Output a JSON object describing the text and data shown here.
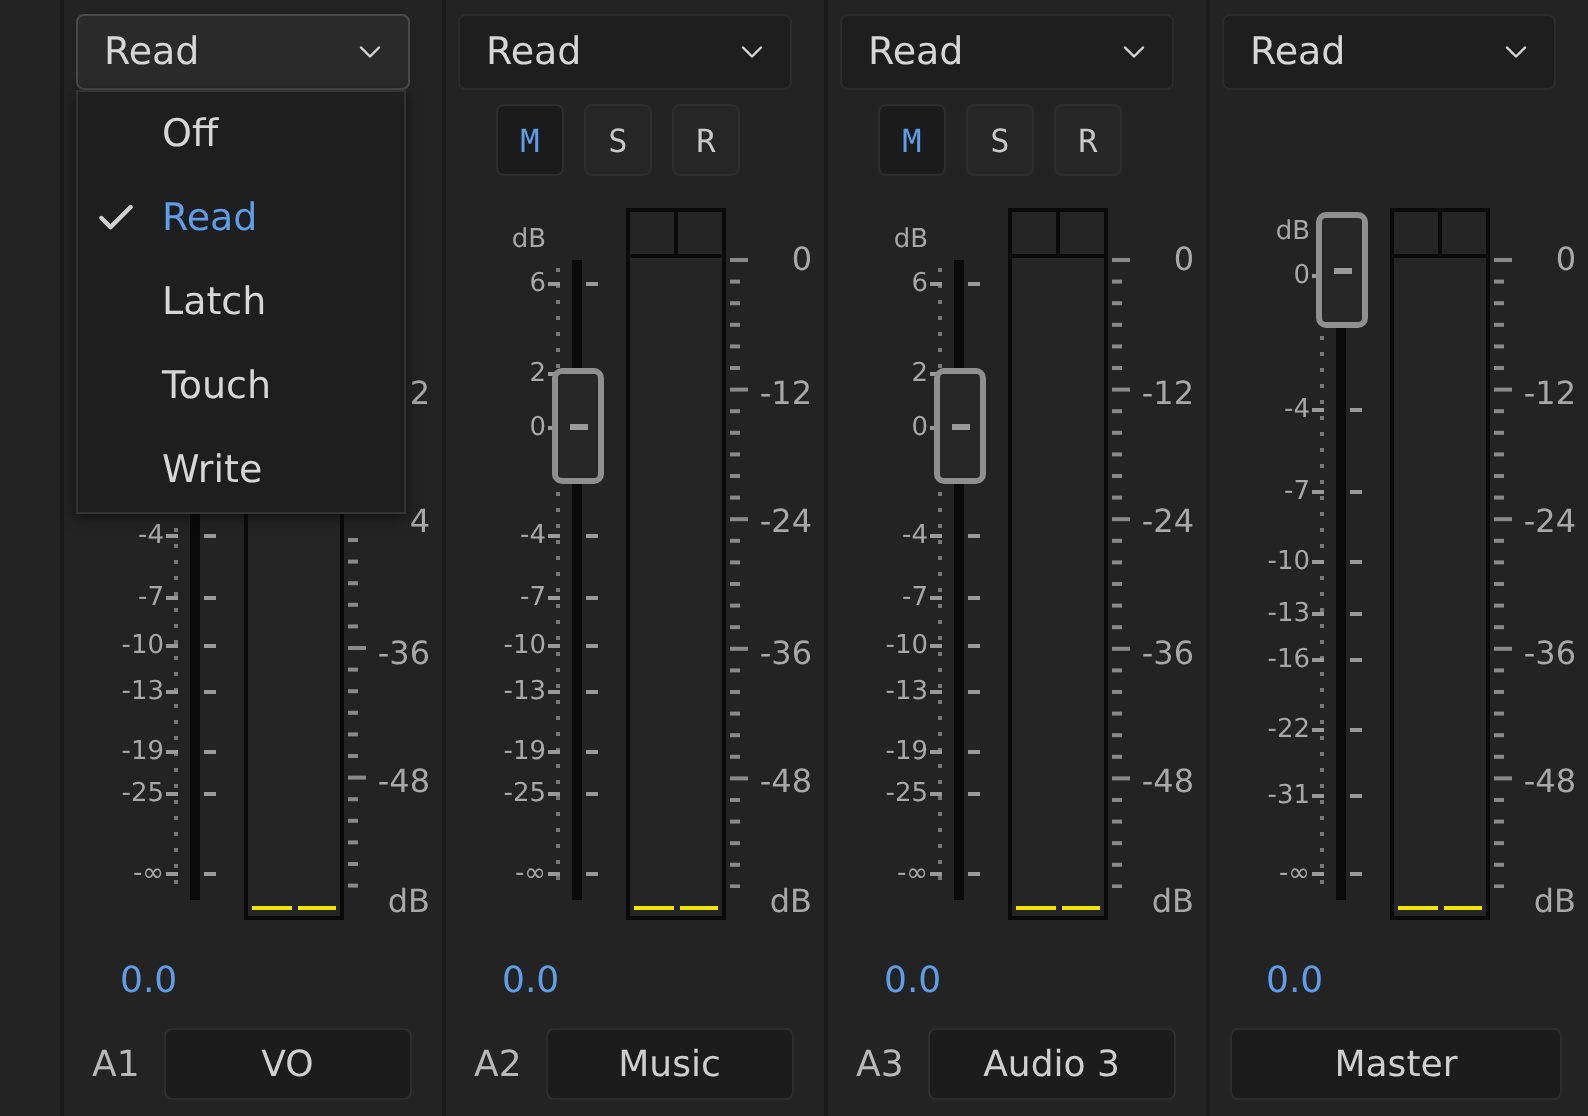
{
  "channels": [
    {
      "kind": "track",
      "automation": {
        "value": "Read",
        "expanded": true,
        "options": [
          {
            "label": "Off",
            "selected": false
          },
          {
            "label": "Read",
            "selected": true
          },
          {
            "label": "Latch",
            "selected": false
          },
          {
            "label": "Touch",
            "selected": false
          },
          {
            "label": "Write",
            "selected": false
          }
        ]
      },
      "fader": {
        "scale": [
          "-4",
          "-7",
          "-10",
          "-13",
          "-19",
          "-25",
          "-∞"
        ]
      },
      "meter": {
        "level": 0,
        "scale": [
          "2",
          "4",
          "-36",
          "-48",
          "dB"
        ]
      },
      "readout": "0.0",
      "track": "A1",
      "name": "VO"
    },
    {
      "kind": "track",
      "automation": {
        "value": "Read",
        "expanded": false
      },
      "buttons": [
        {
          "label": "M",
          "on": true
        },
        {
          "label": "S",
          "on": false
        },
        {
          "label": "R",
          "on": false
        }
      ],
      "fader": {
        "unit": "dB",
        "level": 0.74,
        "scale": [
          "6",
          "2",
          "0",
          "-4",
          "-7",
          "-10",
          "-13",
          "-19",
          "-25",
          "-∞"
        ]
      },
      "meter": {
        "level": 0,
        "scale": [
          "0",
          "-12",
          "-24",
          "-36",
          "-48",
          "dB"
        ]
      },
      "readout": "0.0",
      "track": "A2",
      "name": "Music"
    },
    {
      "kind": "track",
      "automation": {
        "value": "Read",
        "expanded": false
      },
      "buttons": [
        {
          "label": "M",
          "on": true
        },
        {
          "label": "S",
          "on": false
        },
        {
          "label": "R",
          "on": false
        }
      ],
      "fader": {
        "unit": "dB",
        "level": 0.74,
        "scale": [
          "6",
          "2",
          "0",
          "-4",
          "-7",
          "-10",
          "-13",
          "-19",
          "-25",
          "-∞"
        ]
      },
      "meter": {
        "level": 0,
        "scale": [
          "0",
          "-12",
          "-24",
          "-36",
          "-48",
          "dB"
        ]
      },
      "readout": "0.0",
      "track": "A3",
      "name": "Audio 3"
    },
    {
      "kind": "master",
      "automation": {
        "value": "Read",
        "expanded": false
      },
      "fader": {
        "unit": "dB",
        "level": 0.92,
        "scale": [
          "0",
          "-4",
          "-7",
          "-10",
          "-13",
          "-16",
          "-22",
          "-31",
          "-∞"
        ]
      },
      "meter": {
        "level": 0,
        "scale": [
          "0",
          "-12",
          "-24",
          "-36",
          "-48",
          "dB"
        ]
      },
      "readout": "0.0",
      "name": "Master"
    }
  ]
}
